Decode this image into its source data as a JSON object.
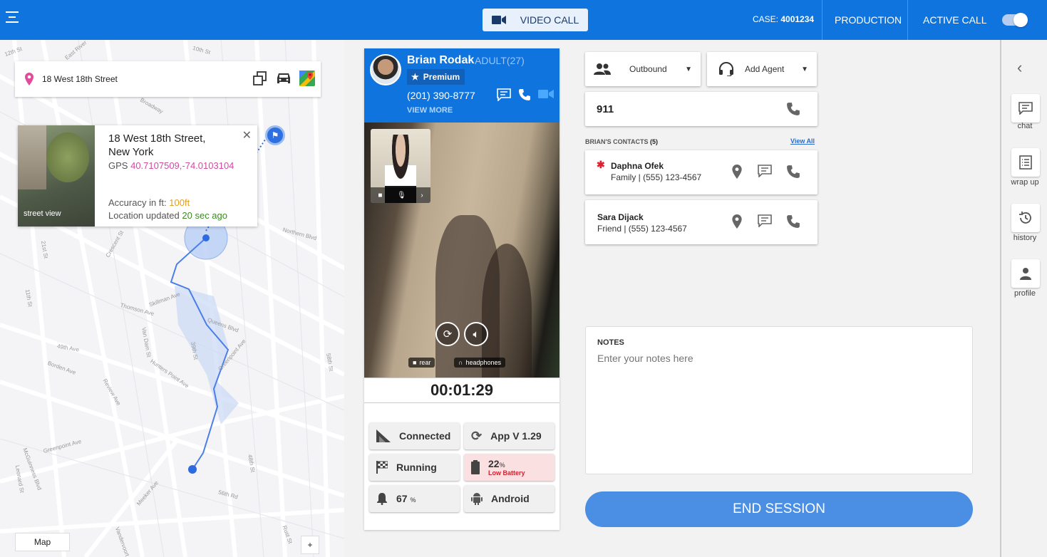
{
  "topbar": {
    "video_call_label": "VIDEO CALL",
    "case_prefix": "CASE:",
    "case_number": "4001234",
    "production_label": "PRODUCTION",
    "active_call_label": "ACTIVE CALL",
    "active_call_on": true
  },
  "map": {
    "address": "18 West 18th Street",
    "info": {
      "title_line1": "18 West 18th Street,",
      "title_line2": "New York",
      "gps_label": "GPS",
      "gps_value": "40.7107509,-74.0103104",
      "accuracy_label": "Accuracy in ft:",
      "accuracy_value": "100ft",
      "updated_label": "Location updated",
      "updated_value": "20 sec ago",
      "street_view_label": "street view"
    },
    "map_type_label": "Map",
    "zoom_in_label": "+",
    "streets": [
      "12th St",
      "East River",
      "10th St",
      "Broadway",
      "Crescent St",
      "Northern Blvd",
      "Thomson Ave",
      "Skillman Ave",
      "Queens Blvd",
      "Greenpoint Ave",
      "49th Ave",
      "Borden Ave",
      "Van Dam St",
      "Hunters Point Ave",
      "Review Ave",
      "39th St",
      "11th St",
      "21st St",
      "58th St",
      "48th St",
      "56th Rd",
      "McGuinness Blvd",
      "Leonard St",
      "Meeker Ave",
      "Vandervoort",
      "Rust St",
      "Greenpoint Ave"
    ]
  },
  "caller": {
    "name": "Brian Rodak",
    "age": "ADULT(27)",
    "tier": "Premium",
    "phone": "(201) 390-8777",
    "view_more": "VIEW MORE",
    "camera_tag": "rear",
    "audio_tag": "headphones",
    "timer": "00:01:29"
  },
  "stats": {
    "connection": "Connected",
    "app_version": "App V 1.29",
    "state": "Running",
    "battery": "22",
    "battery_unit": "%",
    "battery_warning": "Low Battery",
    "volume": "67",
    "volume_unit": "%",
    "platform": "Android"
  },
  "controls": {
    "direction": "Outbound",
    "add_agent": "Add Agent",
    "dial_number": "911"
  },
  "contacts": {
    "header": "BRIAN'S CONTACTS",
    "count": "(5)",
    "view_all": "View All",
    "items": [
      {
        "name": "Daphna Ofek",
        "detail": "Family | (555) 123-4567",
        "primary": true
      },
      {
        "name": "Sara Dijack",
        "detail": "Friend | (555) 123-4567",
        "primary": false
      }
    ]
  },
  "notes": {
    "label": "NOTES",
    "placeholder": "Enter your notes here"
  },
  "end_session_label": "END SESSION",
  "sidebar": {
    "items": [
      {
        "label": "chat",
        "icon": "chat-icon"
      },
      {
        "label": "wrap up",
        "icon": "wrap-up-icon"
      },
      {
        "label": "history",
        "icon": "history-icon"
      },
      {
        "label": "profile",
        "icon": "profile-icon"
      }
    ]
  },
  "colors": {
    "primary": "#0f74de",
    "gps": "#d04ca0",
    "accuracy": "#e0a020",
    "updated": "#3a8a20",
    "warning": "#d02030",
    "end_button": "#4a8fe3"
  }
}
